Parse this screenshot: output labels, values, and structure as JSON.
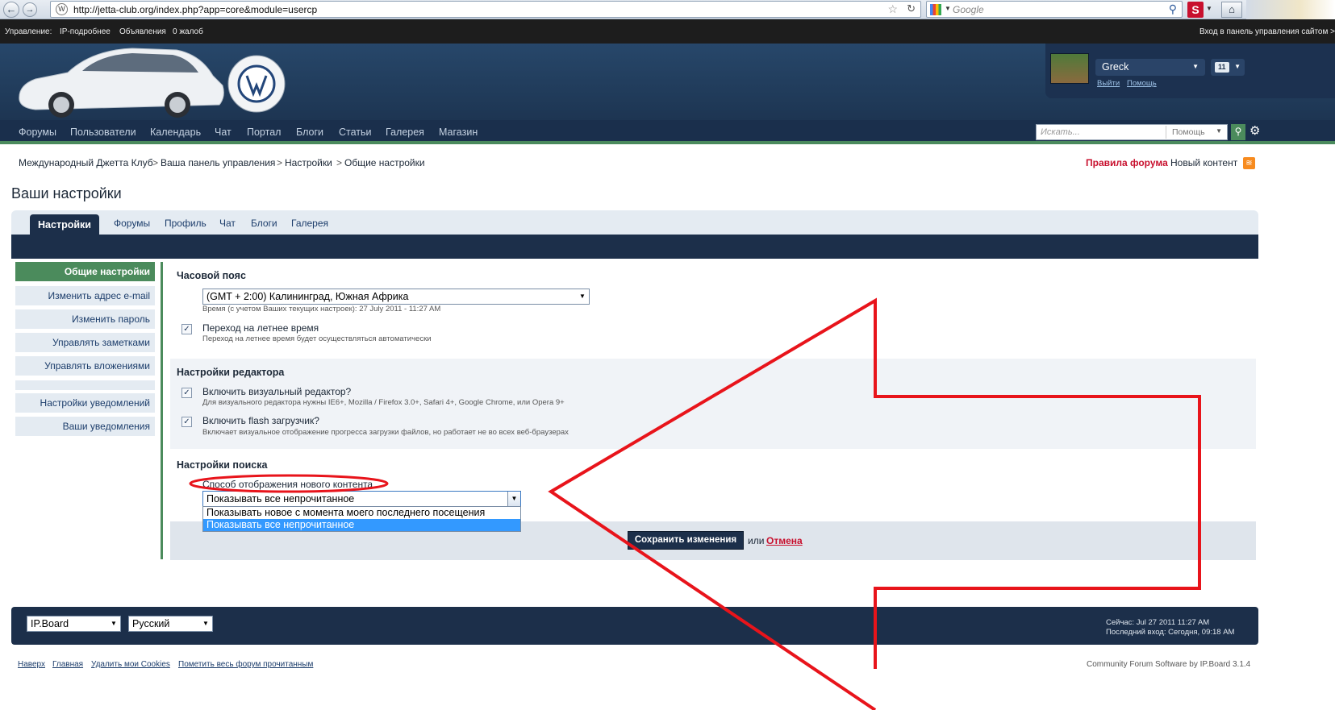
{
  "browser": {
    "url": "http://jetta-club.org/index.php?app=core&module=usercp",
    "search_placeholder": "Google"
  },
  "admin_bar": {
    "label": "Управление:",
    "items": [
      "IP-подробнее",
      "Объявления",
      "0 жалоб"
    ],
    "right_link": "Вход в панель управления сайтом >"
  },
  "user": {
    "name": "Greck",
    "count": "11",
    "logout": "Выйти",
    "help": "Помощь"
  },
  "nav": {
    "items": [
      "Форумы",
      "Пользователи",
      "Календарь",
      "Чат",
      "Портал",
      "Блоги",
      "Статьи",
      "Галерея",
      "Магазин"
    ],
    "search_placeholder": "Искать...",
    "search_scope": "Помощь"
  },
  "breadcrumb": {
    "items": [
      "Международный Джетта Клуб",
      "Ваша панель управления",
      "Настройки",
      "Общие настройки"
    ],
    "rules_link": "Правила форума",
    "new_content": "Новый контент"
  },
  "page_title": "Ваши настройки",
  "tabs": [
    "Настройки",
    "Форумы",
    "Профиль",
    "Чат",
    "Блоги",
    "Галерея"
  ],
  "sidebar": {
    "items": [
      "Общие настройки",
      "Изменить адрес e-mail",
      "Изменить пароль",
      "Управлять заметками",
      "Управлять вложениями",
      "Настройки уведомлений",
      "Ваши уведомления"
    ]
  },
  "timezone": {
    "heading": "Часовой пояс",
    "selected": "(GMT + 2:00) Калининград, Южная Африка",
    "hint": "Время (с учетом Ваших текущих настроек): 27 July 2011 - 11:27 AM",
    "dst_label": "Переход на летнее время",
    "dst_desc": "Переход на летнее время будет осуществляться автоматически"
  },
  "editor": {
    "heading": "Настройки редактора",
    "rte_label": "Включить визуальный редактор?",
    "rte_desc": "Для визуального редактора нужны IE6+, Mozilla / Firefox 3.0+, Safari 4+, Google Chrome, или Opera 9+",
    "flash_label": "Включить flash загрузчик?",
    "flash_desc": "Включает визуальное отображение прогресса загрузки файлов, но работает не во всех веб-браузерах"
  },
  "search_settings": {
    "heading": "Настройки поиска",
    "label": "Способ отображения нового контента",
    "selected": "Показывать все непрочитанное",
    "options": [
      "Показывать новое с момента моего последнего посещения",
      "Показывать все непрочитанное"
    ]
  },
  "actions": {
    "save": "Сохранить изменения",
    "or": "или",
    "cancel": "Отмена"
  },
  "footer": {
    "skin": "IP.Board",
    "language": "Русский",
    "now": "Сейчас: Jul 27 2011 11:27 AM",
    "last_visit": "Последний вход: Сегодня, 09:18 AM",
    "links": [
      "Наверх",
      "Главная",
      "Удалить мои Cookies",
      "Пометить весь форум прочитанным"
    ],
    "copyright": "Community Forum Software by IP.Board 3.1.4"
  },
  "colors": {
    "accent_green": "#4b8b5c",
    "nav_dark": "#1c2f4a",
    "annotation_red": "#e8141b"
  }
}
